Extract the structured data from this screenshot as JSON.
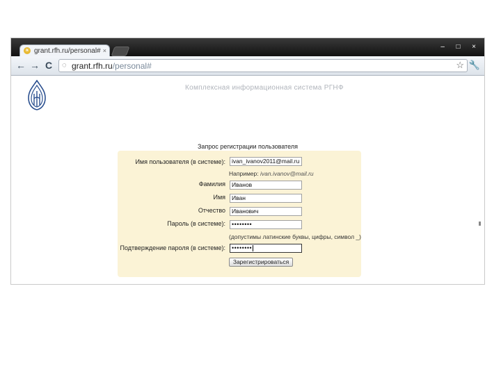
{
  "browser": {
    "tab_title": "grant.rfh.ru/personal#",
    "tab_close": "×",
    "window_controls": [
      "–",
      "□",
      "×"
    ],
    "url_host": "grant.rfh.ru",
    "url_path": "/personal#",
    "back_glyph": "←",
    "forward_glyph": "→",
    "reload_glyph": "C",
    "star_glyph": "☆",
    "wrench_glyph": "🔧"
  },
  "page": {
    "site_title": "Комплексная информационная система РГНФ",
    "form_title": "Запрос регистрации пользователя",
    "fields": {
      "username": {
        "label": "Имя пользователя (в системе):",
        "value": "ivan_ivanov2011@mail.ru",
        "hint_prefix": "Например:",
        "hint_example": "ivan.ivanov@mail.ru"
      },
      "surname": {
        "label": "Фамилия",
        "value": "Иванов"
      },
      "name": {
        "label": "Имя",
        "value": "Иван"
      },
      "patronymic": {
        "label": "Отчество",
        "value": "Иванович"
      },
      "password": {
        "label": "Пароль (в системе):",
        "value": "••••••••",
        "hint": "(допустимы латинские буквы, цифры, символ _)"
      },
      "password_confirm": {
        "label": "Подтверждение пароля (в системе):",
        "value": "••••••••"
      }
    },
    "submit_label": "Зарегистрироваться"
  },
  "colors": {
    "panel_bg": "#fbf3d6",
    "logo_blue": "#2a4f8f"
  }
}
